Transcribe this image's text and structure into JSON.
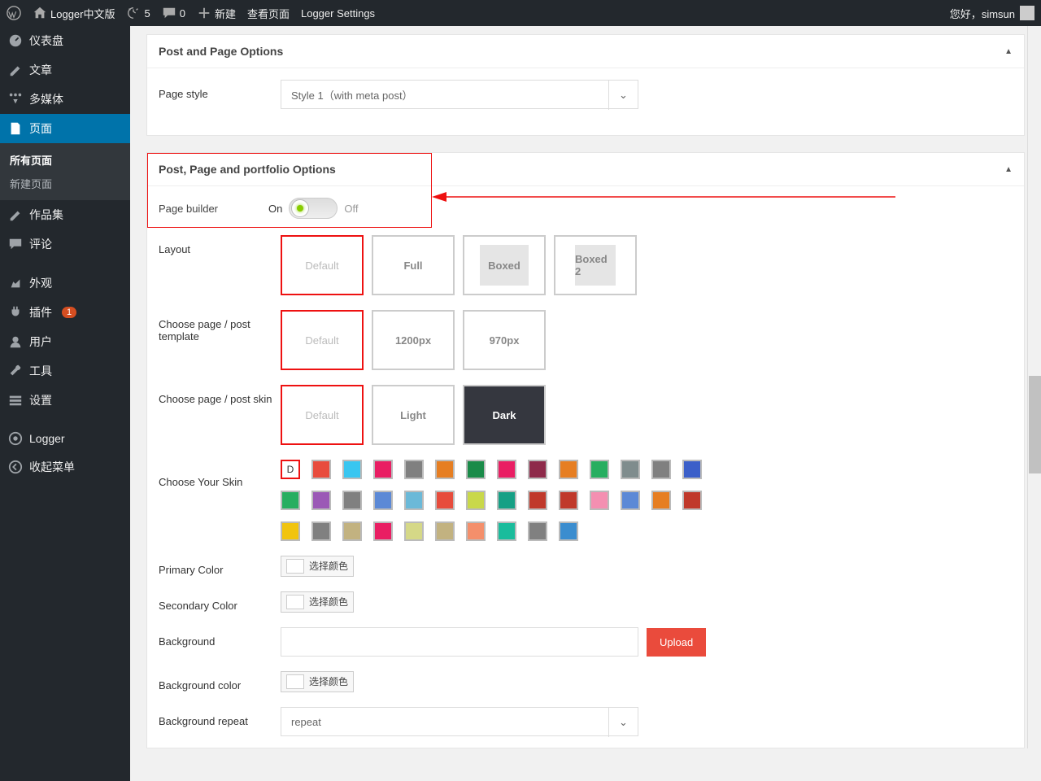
{
  "topbar": {
    "site_name": "Logger中文版",
    "refresh_count": "5",
    "comment_count": "0",
    "new_label": "新建",
    "view_page": "查看页面",
    "logger_settings": "Logger Settings",
    "greeting": "您好，",
    "username": "simsun"
  },
  "sidebar": {
    "dashboard": "仪表盘",
    "posts": "文章",
    "media": "多媒体",
    "pages": "页面",
    "pages_sub": {
      "all": "所有页面",
      "new": "新建页面"
    },
    "portfolio": "作品集",
    "comments": "评论",
    "appearance": "外观",
    "plugins": "插件",
    "plugins_count": "1",
    "users": "用户",
    "tools": "工具",
    "settings": "设置",
    "logger": "Logger",
    "collapse": "收起菜单"
  },
  "panel1": {
    "title": "Post and Page Options",
    "page_style_label": "Page style",
    "page_style_value": "Style 1（with meta post）"
  },
  "panel2": {
    "title": "Post, Page and portfolio Options",
    "page_builder_label": "Page builder",
    "on": "On",
    "off": "Off",
    "layout_label": "Layout",
    "layout_opts": [
      "Default",
      "Full",
      "Boxed",
      "Boxed 2"
    ],
    "template_label": "Choose page / post template",
    "template_opts": [
      "Default",
      "1200px",
      "970px"
    ],
    "skin_label": "Choose page / post skin",
    "skin_opts": [
      "Default",
      "Light",
      "Dark"
    ],
    "choose_skin_label": "Choose Your Skin",
    "skin_d": "D",
    "primary_color_label": "Primary Color",
    "secondary_color_label": "Secondary Color",
    "pick_color": "选择颜色",
    "background_label": "Background",
    "upload": "Upload",
    "bg_color_label": "Background color",
    "bg_repeat_label": "Background repeat",
    "bg_repeat_value": "repeat"
  },
  "skin_colors": [
    "#e84c3d",
    "#39c6f0",
    "#e91e63",
    "#808080",
    "#e67e22",
    "#1a8b49",
    "#e91e63",
    "#8e2a4a",
    "#e67e22",
    "#27ae60",
    "#7f8c8d",
    "#808080",
    "#3b5fc9",
    "#27ae60",
    "#9b59b6",
    "#808080",
    "#5c89d6",
    "#6bb9d8",
    "#e74c3c",
    "#c9d84a",
    "#16a085",
    "#c0392b",
    "#c0392b",
    "#f48fb1",
    "#5c89d6",
    "#e67e22",
    "#c0392b",
    "#f1c40f",
    "#808080",
    "#c2b280",
    "#e91e63",
    "#d5d887",
    "#c2b280",
    "#f48f6b",
    "#1abc9c",
    "#808080",
    "#3b8dcf"
  ]
}
